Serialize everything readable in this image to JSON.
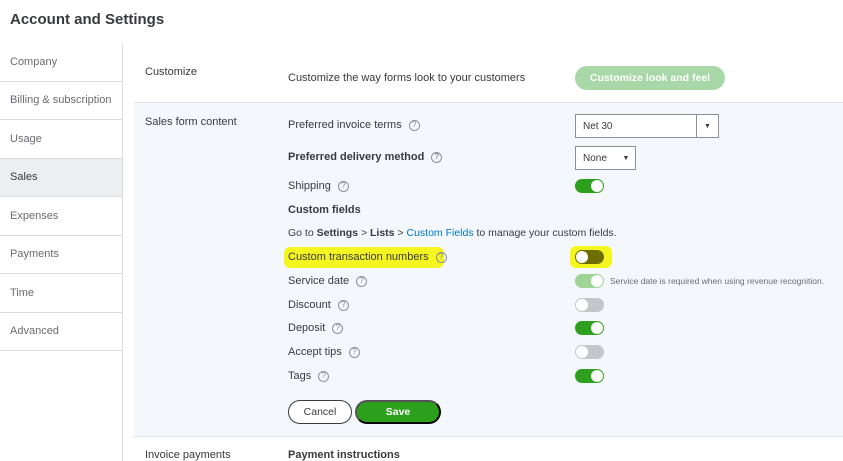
{
  "page_title": "Account and Settings",
  "sidebar": {
    "items": [
      {
        "label": "Company"
      },
      {
        "label": "Billing & subscription"
      },
      {
        "label": "Usage"
      },
      {
        "label": "Sales"
      },
      {
        "label": "Expenses"
      },
      {
        "label": "Payments"
      },
      {
        "label": "Time"
      },
      {
        "label": "Advanced"
      }
    ],
    "active": "Sales"
  },
  "customize": {
    "section_label": "Customize",
    "description": "Customize the way forms look to your customers",
    "button_label": "Customize look and feel"
  },
  "sales_form_content": {
    "section_label": "Sales form content",
    "preferred_invoice_terms": {
      "label": "Preferred invoice terms",
      "value": "Net 30"
    },
    "preferred_delivery_method": {
      "label": "Preferred delivery method",
      "value": "None"
    },
    "shipping": {
      "label": "Shipping",
      "enabled": true
    },
    "custom_fields": {
      "heading": "Custom fields",
      "text_prefix": "Go to ",
      "settings": "Settings",
      "sep1": " > ",
      "lists": "Lists",
      "sep2": " > ",
      "link": "Custom Fields",
      "text_suffix": " to manage your custom fields."
    },
    "custom_transaction_numbers": {
      "label": "Custom transaction numbers",
      "enabled": false
    },
    "service_date": {
      "label": "Service date",
      "enabled": true,
      "hint": "Service date is required when using revenue recognition."
    },
    "discount": {
      "label": "Discount",
      "enabled": false
    },
    "deposit": {
      "label": "Deposit",
      "enabled": true
    },
    "accept_tips": {
      "label": "Accept tips",
      "enabled": false
    },
    "tags": {
      "label": "Tags",
      "enabled": true
    },
    "cancel_label": "Cancel",
    "save_label": "Save"
  },
  "invoice_payments": {
    "section_label": "Invoice payments",
    "payment_instructions": "Payment instructions"
  },
  "icons": {
    "help": "?",
    "caret": "▼"
  },
  "colors": {
    "accent_green": "#2ca01c",
    "link_blue": "#0077c5",
    "highlight_yellow": "#f5f51f"
  }
}
